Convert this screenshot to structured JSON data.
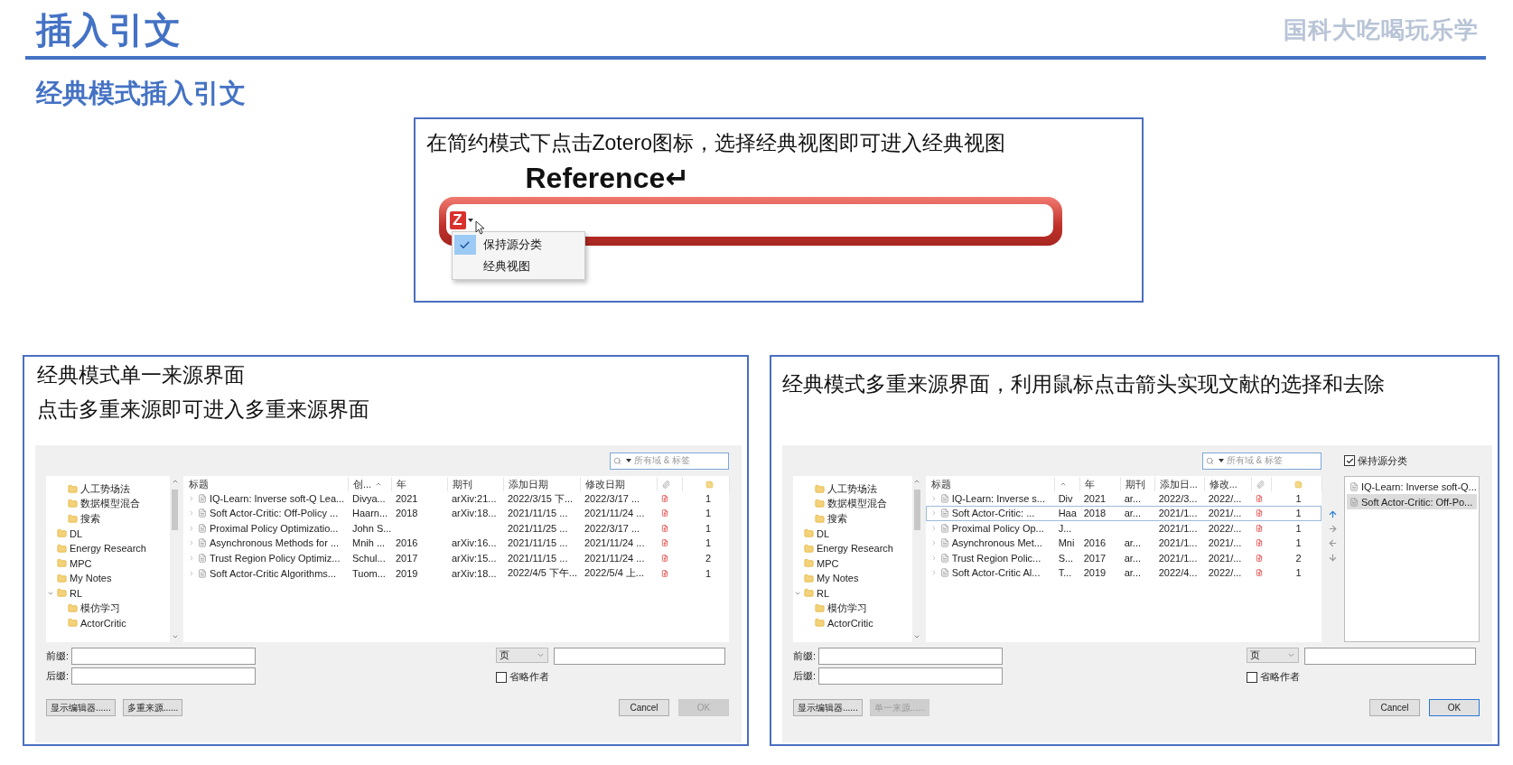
{
  "header": {
    "title": "插入引文",
    "logo_text": "国科大吃喝玩乐学"
  },
  "subtitle": "经典模式插入引文",
  "top_panel": {
    "caption": "在简约模式下点击Zotero图标，选择经典视图即可进入经典视图",
    "document_text": "Reference↵",
    "logo": "Z",
    "menu": [
      {
        "label": "保持源分类",
        "checked": true
      },
      {
        "label": "经典视图",
        "checked": false
      }
    ]
  },
  "panels": [
    {
      "kind": "single",
      "captions": [
        "经典模式单一来源界面",
        "点击多重来源即可进入多重来源界面"
      ],
      "dialog": {
        "search_placeholder": "所有域 & 标签",
        "tree": [
          {
            "children": [
              {
                "label": "人工势场法"
              },
              {
                "label": "数据模型混合"
              },
              {
                "label": "搜索"
              }
            ]
          },
          {
            "label": "DL"
          },
          {
            "label": "Energy Research"
          },
          {
            "label": "MPC"
          },
          {
            "label": "My Notes"
          },
          {
            "label": "RL",
            "expanded": true,
            "children": [
              {
                "label": "模仿学习"
              },
              {
                "label": "ActorCritic"
              }
            ]
          }
        ],
        "columns": [
          {
            "kind": "text",
            "label": "标题",
            "sorted": false
          },
          {
            "kind": "text",
            "label": "创...",
            "sorted": true
          },
          {
            "kind": "text",
            "label": "年",
            "sorted": false
          },
          {
            "kind": "text",
            "label": "期刊",
            "sorted": false
          },
          {
            "kind": "text",
            "label": "添加日期",
            "sorted": false
          },
          {
            "kind": "text",
            "label": "修改日期",
            "sorted": false
          },
          {
            "kind": "attachment"
          },
          {
            "kind": "notes"
          }
        ],
        "rows": [
          {
            "cells": [
              "IQ-Learn: Inverse soft-Q Lea...",
              "Divya...",
              "2021",
              "arXiv:21...",
              "2022/3/15 下...",
              "2022/3/17 ..."
            ],
            "attachment": true,
            "notes": "1",
            "selected": false
          },
          {
            "cells": [
              "Soft Actor-Critic: Off-Policy ...",
              "Haarn...",
              "2018",
              "arXiv:18...",
              "2021/11/15 ...",
              "2021/11/24 ..."
            ],
            "attachment": true,
            "notes": "1",
            "selected": false
          },
          {
            "cells": [
              "Proximal Policy Optimizatio...",
              "John S...",
              null,
              null,
              "2021/11/25 ...",
              "2022/3/17 ..."
            ],
            "attachment": true,
            "notes": "1",
            "selected": false
          },
          {
            "cells": [
              "Asynchronous Methods for ...",
              "Mnih ...",
              "2016",
              "arXiv:16...",
              "2021/11/15 ...",
              "2021/11/24 ..."
            ],
            "attachment": true,
            "notes": "1",
            "selected": false
          },
          {
            "cells": [
              "Trust Region Policy Optimiz...",
              "Schul...",
              "2017",
              "arXiv:15...",
              "2021/11/15 ...",
              "2021/11/24 ..."
            ],
            "attachment": true,
            "notes": "2",
            "selected": false
          },
          {
            "cells": [
              "Soft Actor-Critic Algorithms...",
              "Tuom...",
              "2019",
              "arXiv:18...",
              "2022/4/5 下午...",
              "2022/5/4 上..."
            ],
            "attachment": true,
            "notes": "1",
            "selected": false
          }
        ],
        "prefix_label": "前缀:",
        "suffix_label": "后缀:",
        "locator": "页",
        "omit_author": {
          "label": "省略作者",
          "checked": false
        },
        "actions_left": [
          {
            "label": "显示编辑器......",
            "disabled": false
          },
          {
            "label": "多重来源......",
            "disabled": false
          }
        ],
        "actions_right": [
          {
            "label": "Cancel",
            "disabled": false,
            "default": false
          },
          {
            "label": "OK",
            "disabled": true,
            "default": false
          }
        ]
      }
    },
    {
      "kind": "multi",
      "captions": [
        "经典模式多重来源界面，利用鼠标点击箭头实现文献的选择和去除"
      ],
      "dialog": {
        "search_placeholder": "所有域 & 标签",
        "tree": [
          {
            "children": [
              {
                "label": "人工势场法"
              },
              {
                "label": "数据模型混合"
              },
              {
                "label": "搜索"
              }
            ]
          },
          {
            "label": "DL"
          },
          {
            "label": "Energy Research"
          },
          {
            "label": "MPC"
          },
          {
            "label": "My Notes"
          },
          {
            "label": "RL",
            "expanded": true,
            "children": [
              {
                "label": "模仿学习"
              },
              {
                "label": "ActorCritic"
              }
            ]
          }
        ],
        "columns": [
          {
            "kind": "text",
            "label": "标题",
            "sorted": false
          },
          {
            "kind": "text",
            "sorted": true
          },
          {
            "kind": "text",
            "label": "年",
            "sorted": false
          },
          {
            "kind": "text",
            "label": "期刊",
            "sorted": false
          },
          {
            "kind": "text",
            "label": "添加日...",
            "sorted": false
          },
          {
            "kind": "text",
            "label": "修改...",
            "sorted": false
          },
          {
            "kind": "attachment"
          },
          {
            "kind": "notes"
          }
        ],
        "rows": [
          {
            "cells": [
              "IQ-Learn: Inverse s...",
              "Div",
              "2021",
              "ar...",
              "2022/3...",
              "2022/..."
            ],
            "attachment": true,
            "notes": "1",
            "selected": false
          },
          {
            "cells": [
              "Soft Actor-Critic: ...",
              "Haa",
              "2018",
              "ar...",
              "2021/1...",
              "2021/..."
            ],
            "attachment": true,
            "notes": "1",
            "selected": true
          },
          {
            "cells": [
              "Proximal Policy Op...",
              "J...",
              null,
              null,
              "2021/1...",
              "2022/..."
            ],
            "attachment": true,
            "notes": "1",
            "selected": false
          },
          {
            "cells": [
              "Asynchronous Met...",
              "Mni",
              "2016",
              "ar...",
              "2021/1...",
              "2021/..."
            ],
            "attachment": true,
            "notes": "1",
            "selected": false
          },
          {
            "cells": [
              "Trust Region Polic...",
              "S...",
              "2017",
              "ar...",
              "2021/1...",
              "2021/..."
            ],
            "attachment": true,
            "notes": "2",
            "selected": false
          },
          {
            "cells": [
              "Soft Actor-Critic Al...",
              "T...",
              "2019",
              "ar...",
              "2022/4...",
              "2022/..."
            ],
            "attachment": true,
            "notes": "1",
            "selected": false
          }
        ],
        "move_arrows": [
          {
            "kind": "up",
            "disabled": false
          },
          {
            "kind": "right",
            "disabled": true
          },
          {
            "kind": "left",
            "disabled": true
          },
          {
            "kind": "down",
            "disabled": true
          }
        ],
        "keep_sources": {
          "label": "保持源分类",
          "checked": true
        },
        "chosen_items": [
          {
            "label": "IQ-Learn: Inverse soft-Q...",
            "selected": false
          },
          {
            "label": "Soft Actor-Critic: Off-Po...",
            "selected": true
          }
        ],
        "prefix_label": "前缀:",
        "suffix_label": "后缀:",
        "locator": "页",
        "omit_author": {
          "label": "省略作者",
          "checked": false
        },
        "actions_left": [
          {
            "label": "显示编辑器......",
            "disabled": false
          },
          {
            "label": "单一来源......",
            "disabled": true
          }
        ],
        "actions_right": [
          {
            "label": "Cancel",
            "disabled": false,
            "default": false
          },
          {
            "label": "OK",
            "disabled": false,
            "default": true
          }
        ]
      }
    }
  ]
}
